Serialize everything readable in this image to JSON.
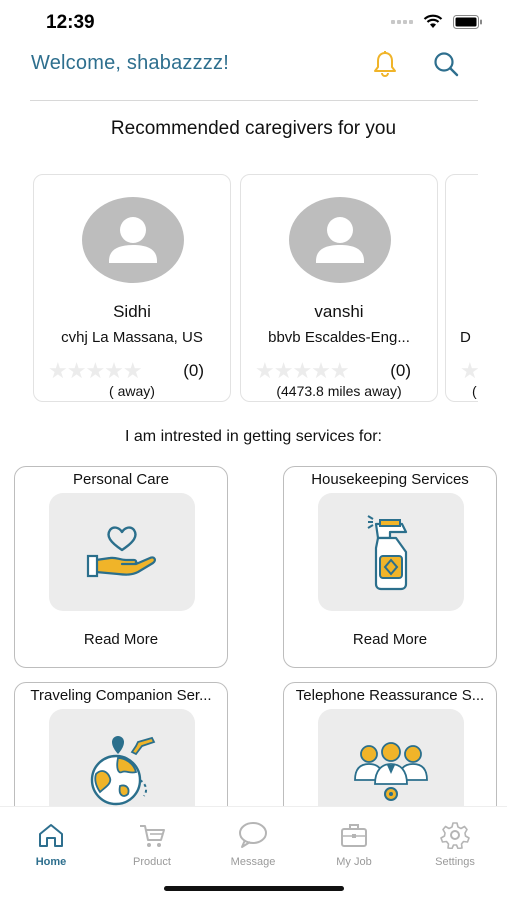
{
  "status": {
    "time": "12:39"
  },
  "header": {
    "welcome": "Welcome, shabazzzz!"
  },
  "recommended": {
    "title": "Recommended caregivers for you",
    "caregivers": [
      {
        "name": "Sidhi",
        "location": "cvhj La Massana, US",
        "rating_count": "(0)",
        "distance": "( away)"
      },
      {
        "name": "vanshi",
        "location": "bbvb Escaldes-Eng...",
        "rating_count": "(0)",
        "distance": "(4473.8 miles away)"
      },
      {
        "name": "",
        "location": "D",
        "rating_count": "",
        "distance": "("
      }
    ]
  },
  "services": {
    "intro": "I am intrested in getting services for:",
    "items": [
      {
        "title": "Personal Care",
        "more": "Read More",
        "icon": "heart-hand-icon"
      },
      {
        "title": "Housekeeping Services",
        "more": "Read More",
        "icon": "spray-bottle-icon"
      },
      {
        "title": "Traveling Companion Ser...",
        "more": "",
        "icon": "globe-plane-icon"
      },
      {
        "title": "Telephone Reassurance S...",
        "more": "",
        "icon": "people-group-icon"
      }
    ]
  },
  "nav": {
    "items": [
      {
        "label": "Home",
        "icon": "home-icon",
        "active": true
      },
      {
        "label": "Product",
        "icon": "cart-icon"
      },
      {
        "label": "Message",
        "icon": "chat-icon"
      },
      {
        "label": "My Job",
        "icon": "briefcase-icon"
      },
      {
        "label": "Settings",
        "icon": "gear-icon"
      }
    ]
  },
  "colors": {
    "accent": "#2e6f8e",
    "icon_yellow": "#f0b429",
    "icon_blue": "#2b6f8c",
    "avatar_gray": "#bdbdbd"
  }
}
